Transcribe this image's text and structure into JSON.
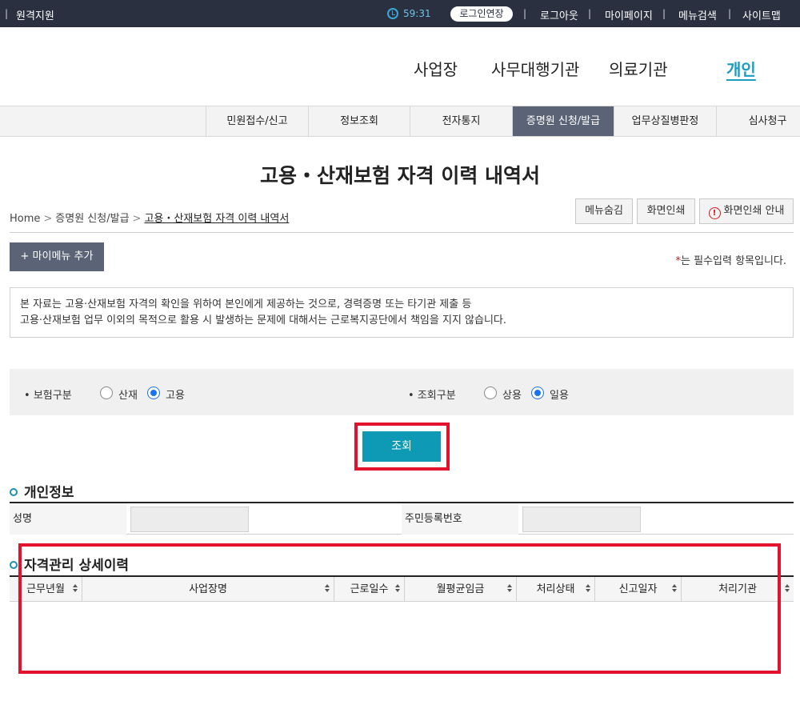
{
  "topbar": {
    "remote_support": "원격지원",
    "timer_icon": "clock-icon",
    "timer": "59:31",
    "login_extend": "로그인연장",
    "links": [
      "로그아웃",
      "마이페이지",
      "메뉴검색",
      "사이트맵"
    ]
  },
  "main_nav": [
    "사업장",
    "사무대행기관",
    "의료기관",
    "개인"
  ],
  "sub_nav": [
    "민원접수/신고",
    "정보조회",
    "전자통지",
    "증명원 신청/발급",
    "업무상질병판정",
    "심사청구"
  ],
  "page": {
    "title": "고용・산재보험 자격 이력 내역서"
  },
  "breadcrumb": {
    "home": "Home",
    "level1": "증명원 신청/발급",
    "current": "고용・산재보험 자격 이력 내역서"
  },
  "util_buttons": {
    "hide_menu": "메뉴숨김",
    "print": "화면인쇄",
    "print_guide": "화면인쇄 안내"
  },
  "my_menu": {
    "label": "+ 마이메뉴 추가"
  },
  "required_note": {
    "star": "*",
    "text": "는 필수입력 항목입니다."
  },
  "notice": {
    "line1": "본 자료는 고용·산재보험 자격의 확인을 위하여 본인에게 제공하는 것으로, 경력증명 또는 타기관 제출 등",
    "line2": "고용·산재보험 업무 이외의 목적으로 활용 시 발생하는 문제에 대해서는 근로복지공단에서 책임을 지지 않습니다."
  },
  "search": {
    "insurance_label": "보험구분",
    "insurance_options": [
      "산재",
      "고용"
    ],
    "insurance_selected": "고용",
    "query_label": "조회구분",
    "query_options": [
      "상용",
      "일용"
    ],
    "query_selected": "일용",
    "button": "조회"
  },
  "personal_info": {
    "title": "개인정보",
    "name_label": "성명",
    "name_value": "",
    "rrn_label": "주민등록번호",
    "rrn_value": ""
  },
  "history": {
    "title": "자격관리 상세이력",
    "columns": [
      "근무년월",
      "사업장명",
      "근로일수",
      "월평균임금",
      "처리상태",
      "신고일자",
      "처리기관"
    ],
    "rows": []
  },
  "colors": {
    "topbar_bg": "#2b3040",
    "accent": "#0e9ab5",
    "active_tab": "#5b6477",
    "highlight": "#e3132e"
  }
}
